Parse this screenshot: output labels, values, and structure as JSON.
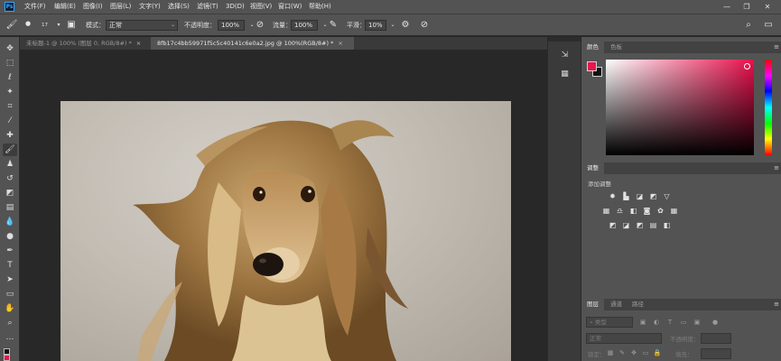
{
  "app": {
    "logo_text": "Ps"
  },
  "menu": [
    "文件(F)",
    "编辑(E)",
    "图像(I)",
    "图层(L)",
    "文字(Y)",
    "选择(S)",
    "滤镜(T)",
    "3D(D)",
    "视图(V)",
    "窗口(W)",
    "帮助(H)"
  ],
  "window_controls": {
    "minimize": "—",
    "restore": "❐",
    "close": "✕"
  },
  "options": {
    "brush_size": "17",
    "mode_label": "模式：",
    "mode_value": "正常",
    "opacity_label": "不透明度：",
    "opacity_value": "100%",
    "flow_label": "流量：",
    "flow_value": "100%",
    "smoothing_label": "平滑：",
    "smoothing_value": "10%"
  },
  "tabs": [
    {
      "label": "未标题-1 @ 100% (图层 0, RGB/8#) *",
      "close": "×"
    },
    {
      "label": "8fb17c4bb59971f5c5c40141c6e0a2.jpg @ 100%(RGB/8#) *",
      "close": "×"
    }
  ],
  "panels": {
    "color_tabs": [
      "颜色",
      "色板"
    ],
    "adjust_tab": "调整",
    "adjust_title": "添加调整",
    "layers_tabs": [
      "图层",
      "通道",
      "路径"
    ],
    "layer_search_placeholder": "类型",
    "blend_mode": "正常",
    "layer_opacity_label": "不透明度：",
    "lock_label": "锁定：",
    "fill_label": "填充："
  },
  "colors": {
    "foreground": "#e8174b",
    "background": "#101010",
    "accent": "#31a8ff"
  }
}
